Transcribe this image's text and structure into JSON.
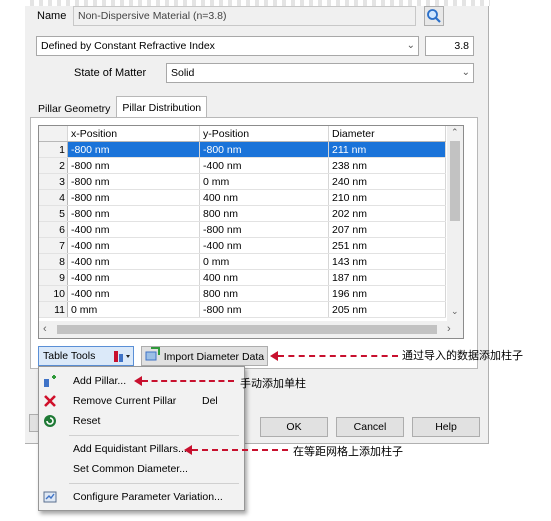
{
  "material": {
    "name_label": "Name",
    "name_value": "Non-Dispersive Material (n=3.8)",
    "definition": "Defined by Constant Refractive Index",
    "refractive_index": "3.8",
    "state_label": "State of Matter",
    "state_value": "Solid"
  },
  "tabs": [
    {
      "label": "Pillar Geometry",
      "active": false
    },
    {
      "label": "Pillar Distribution",
      "active": true
    }
  ],
  "table": {
    "columns": [
      "x-Position",
      "y-Position",
      "Diameter"
    ],
    "rows": [
      {
        "n": "1",
        "x": "-800 nm",
        "y": "-800 nm",
        "d": "211 nm"
      },
      {
        "n": "2",
        "x": "-800 nm",
        "y": "-400 nm",
        "d": "238 nm"
      },
      {
        "n": "3",
        "x": "-800 nm",
        "y": "0 mm",
        "d": "240 nm"
      },
      {
        "n": "4",
        "x": "-800 nm",
        "y": "400 nm",
        "d": "210 nm"
      },
      {
        "n": "5",
        "x": "-800 nm",
        "y": "800 nm",
        "d": "202 nm"
      },
      {
        "n": "6",
        "x": "-400 nm",
        "y": "-800 nm",
        "d": "207 nm"
      },
      {
        "n": "7",
        "x": "-400 nm",
        "y": "-400 nm",
        "d": "251 nm"
      },
      {
        "n": "8",
        "x": "-400 nm",
        "y": "0 mm",
        "d": "143 nm"
      },
      {
        "n": "9",
        "x": "-400 nm",
        "y": "400 nm",
        "d": "187 nm"
      },
      {
        "n": "10",
        "x": "-400 nm",
        "y": "800 nm",
        "d": "196 nm"
      },
      {
        "n": "11",
        "x": "0 mm",
        "y": "-800 nm",
        "d": "205 nm"
      }
    ]
  },
  "buttons": {
    "table_tools": "Table Tools",
    "import_diameter": "Import Diameter Data",
    "ok": "OK",
    "cancel": "Cancel",
    "help": "Help"
  },
  "menu": {
    "add_pillar": "Add Pillar...",
    "remove_current_pillar": "Remove Current Pillar",
    "remove_shortcut": "Del",
    "reset": "Reset",
    "add_equidistant": "Add Equidistant Pillars...",
    "set_common_diameter": "Set Common Diameter...",
    "configure_variation": "Configure Parameter Variation..."
  },
  "annotations": {
    "import": "通过导入的数据添加柱子",
    "manual": "手动添加单柱",
    "grid": "在等距网格上添加柱子"
  },
  "colors": {
    "selection": "#1a73d9",
    "annotation_arrow": "#c8102e"
  }
}
